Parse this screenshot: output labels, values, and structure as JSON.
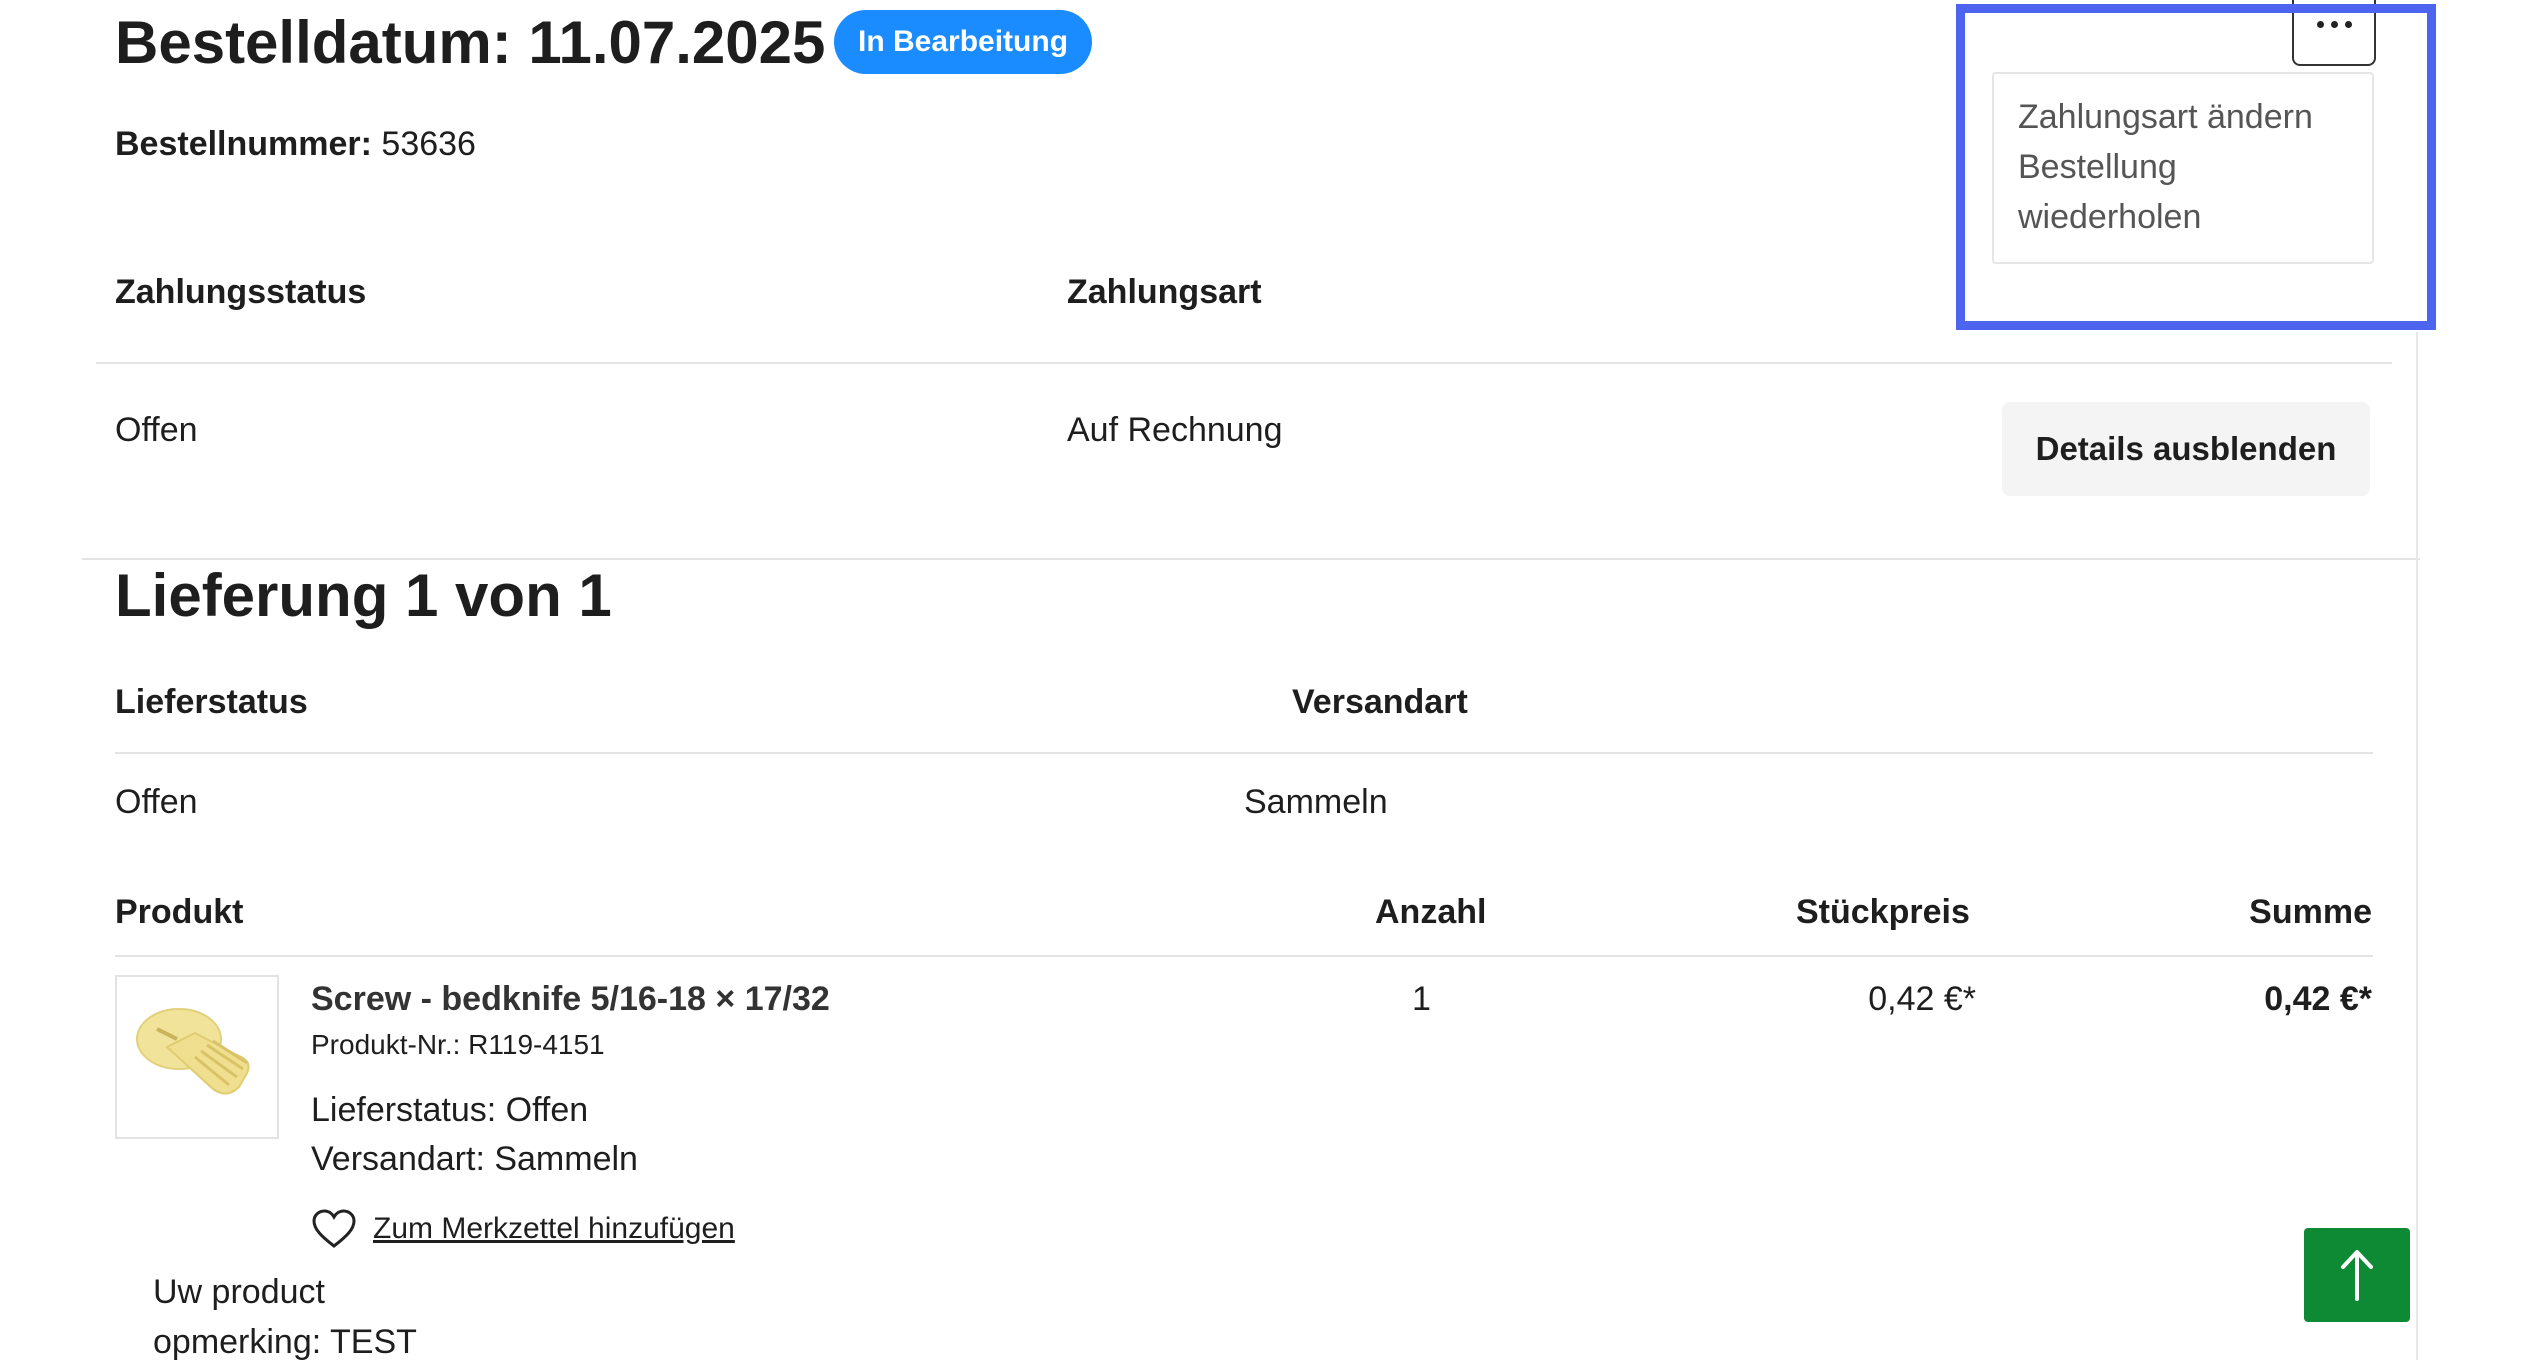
{
  "order": {
    "title": "Bestelldatum: 11.07.2025",
    "status_badge": "In Bearbeitung",
    "number_label": "Bestellnummer:",
    "number_value": "53636"
  },
  "payment": {
    "status_header": "Zahlungsstatus",
    "method_header": "Zahlungsart",
    "status_value": "Offen",
    "method_value": "Auf Rechnung",
    "details_button": "Details ausblenden"
  },
  "menu": {
    "items": [
      "Zahlungsart ändern",
      "Bestellung",
      "wiederholen"
    ]
  },
  "delivery": {
    "title": "Lieferung 1 von 1",
    "status_header": "Lieferstatus",
    "method_header": "Versandart",
    "status_value": "Offen",
    "method_value": "Sammeln"
  },
  "products": {
    "headers": {
      "product": "Produkt",
      "quantity": "Anzahl",
      "unit_price": "Stückpreis",
      "total": "Summe"
    },
    "items": [
      {
        "name": "Screw - bedknife 5/16-18 × 17/32",
        "number": "Produkt-Nr.: R119-4151",
        "delivery_status": "Lieferstatus: Offen",
        "shipping": "Versandart: Sammeln",
        "quantity": "1",
        "unit_price": "0,42 €*",
        "total": "0,42 €*",
        "wishlist_label": "Zum Merkzettel hinzufügen",
        "remark_line1": "Uw product",
        "remark_line2": "opmerking: TEST"
      }
    ]
  },
  "icons": {
    "more": "more-dots-icon",
    "heart": "heart-icon",
    "scroll_top": "arrow-up-icon"
  },
  "colors": {
    "badge": "#1a8cff",
    "highlight": "#4d64f0",
    "scroll_top": "#0e8a35"
  }
}
